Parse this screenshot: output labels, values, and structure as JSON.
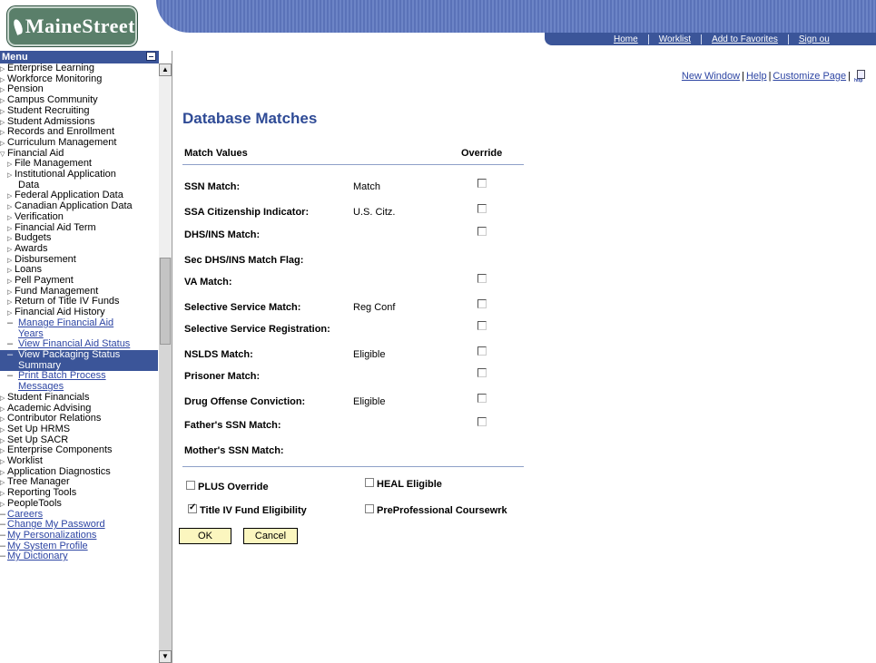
{
  "logo": {
    "text": "MaineStreet"
  },
  "nav": {
    "items": [
      "Home",
      "Worklist",
      "Add to Favorites",
      "Sign ou"
    ]
  },
  "menu": {
    "title": "Menu",
    "items": [
      {
        "label": "Enterprise Learning",
        "level": 0
      },
      {
        "label": "Workforce Monitoring",
        "level": 0
      },
      {
        "label": "Pension",
        "level": 0
      },
      {
        "label": "Campus Community",
        "level": 0
      },
      {
        "label": "Student Recruiting",
        "level": 0
      },
      {
        "label": "Student Admissions",
        "level": 0
      },
      {
        "label": "Records and Enrollment",
        "level": 0
      },
      {
        "label": "Curriculum Management",
        "level": 0
      },
      {
        "label": "Financial Aid",
        "level": 0,
        "open": true
      },
      {
        "label": "File Management",
        "level": 1
      },
      {
        "label": "Institutional Application",
        "level": 1
      },
      {
        "label": "Data",
        "level": "cont"
      },
      {
        "label": "Federal Application Data",
        "level": 1
      },
      {
        "label": "Canadian Application Data",
        "level": 1
      },
      {
        "label": "Verification",
        "level": 1
      },
      {
        "label": "Financial Aid Term",
        "level": 1
      },
      {
        "label": "Budgets",
        "level": 1
      },
      {
        "label": "Awards",
        "level": 1
      },
      {
        "label": "Disbursement",
        "level": 1
      },
      {
        "label": "Loans",
        "level": 1
      },
      {
        "label": "Pell Payment",
        "level": 1
      },
      {
        "label": "Fund Management",
        "level": 1
      },
      {
        "label": "Return of Title IV Funds",
        "level": 1
      },
      {
        "label": "Financial Aid History",
        "level": 1
      },
      {
        "label": "Manage Financial Aid",
        "level": 2,
        "link": true
      },
      {
        "label": "Years",
        "level": "cont",
        "link": true
      },
      {
        "label": "View Financial Aid Status",
        "level": 2,
        "link": true
      },
      {
        "label": "View Packaging Status",
        "level": 2,
        "link": true,
        "selected": true
      },
      {
        "label": "Summary",
        "level": "cont",
        "link": true,
        "selected": true
      },
      {
        "label": "Print Batch Process",
        "level": 2,
        "link": true
      },
      {
        "label": "Messages",
        "level": "cont",
        "link": true
      },
      {
        "label": "Student Financials",
        "level": 0
      },
      {
        "label": "Academic Advising",
        "level": 0
      },
      {
        "label": "Contributor Relations",
        "level": 0
      },
      {
        "label": "Set Up HRMS",
        "level": 0
      },
      {
        "label": "Set Up SACR",
        "level": 0
      },
      {
        "label": "Enterprise Components",
        "level": 0
      },
      {
        "label": "Worklist",
        "level": 0
      },
      {
        "label": "Application Diagnostics",
        "level": 0
      },
      {
        "label": "Tree Manager",
        "level": 0
      },
      {
        "label": "Reporting Tools",
        "level": 0
      },
      {
        "label": "PeopleTools",
        "level": 0
      },
      {
        "label": "Careers",
        "level": 0,
        "link": true,
        "plain": true
      },
      {
        "label": "Change My Password",
        "level": 0,
        "link": true,
        "plain": true
      },
      {
        "label": "My Personalizations",
        "level": 0,
        "link": true,
        "plain": true
      },
      {
        "label": "My System Profile",
        "level": 0,
        "link": true,
        "plain": true
      },
      {
        "label": "My Dictionary",
        "level": 0,
        "link": true,
        "plain": true
      }
    ]
  },
  "toplinks": {
    "new_window": "New Window",
    "help": "Help",
    "customize": "Customize Page",
    "sep": "|",
    "http_icon_text": "http"
  },
  "page": {
    "title": "Database Matches",
    "col_match_values": "Match Values",
    "col_override": "Override",
    "rows": [
      {
        "label": "SSN Match:",
        "value": "Match",
        "override": false,
        "has_cb": true
      },
      {
        "label": "SSA Citizenship Indicator:",
        "value": "U.S. Citz.",
        "override": false,
        "has_cb": true
      },
      {
        "label": "DHS/INS Match:",
        "value": "",
        "override": false,
        "has_cb": true
      },
      {
        "label": "Sec DHS/INS Match Flag:",
        "value": "",
        "override": false,
        "has_cb": false
      },
      {
        "label": "VA Match:",
        "value": "",
        "override": false,
        "has_cb": true
      },
      {
        "label": "Selective Service Match:",
        "value": "Reg Conf",
        "override": false,
        "has_cb": true
      },
      {
        "label": "Selective Service Registration:",
        "value": "",
        "override": false,
        "has_cb": true
      },
      {
        "label": "NSLDS Match:",
        "value": "Eligible",
        "override": false,
        "has_cb": true
      },
      {
        "label": "Prisoner Match:",
        "value": "",
        "override": false,
        "has_cb": true
      },
      {
        "label": "Drug Offense Conviction:",
        "value": "Eligible",
        "override": false,
        "has_cb": true
      },
      {
        "label": "Father's SSN Match:",
        "value": "",
        "override": false,
        "has_cb": true
      },
      {
        "label": "Mother's SSN Match:",
        "value": "",
        "override": false,
        "has_cb": false
      }
    ],
    "options": {
      "plus_override": {
        "label": "PLUS Override",
        "checked": false
      },
      "heal_eligible": {
        "label": "HEAL Eligible",
        "checked": false
      },
      "title_iv": {
        "label": "Title IV Fund Eligibility",
        "checked": true
      },
      "preprofessional": {
        "label": "PreProfessional Coursewrk",
        "checked": false
      }
    },
    "ok_label": "OK",
    "cancel_label": "Cancel"
  }
}
